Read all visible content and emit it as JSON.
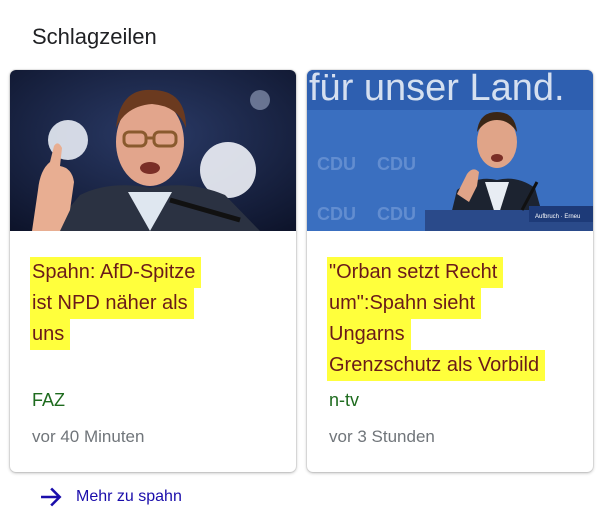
{
  "section": {
    "title": "Schlagzeilen"
  },
  "cards": [
    {
      "headline_lines": [
        "Spahn: AfD-Spitze",
        "ist NPD näher als",
        "uns"
      ],
      "source": "FAZ",
      "time": "vor 40 Minuten",
      "image": "speaker-at-podium-photo"
    },
    {
      "headline_lines": [
        "\"Orban setzt Recht",
        "um\":Spahn sieht",
        "Ungarns",
        "Grenzschutz als Vorbild"
      ],
      "source": "n-tv",
      "time": "vor 3 Stunden",
      "image": "speaker-on-stage-photo",
      "image_text": {
        "banner": "für unser Land.",
        "backdrop": [
          "CDU",
          "CDU",
          "CDU",
          "CDU"
        ],
        "tag": "Aufbruch · Erneu"
      }
    }
  ],
  "more": {
    "label": "Mehr zu spahn",
    "icon": "arrow-right-icon"
  },
  "colors": {
    "highlight": "#ffff3c",
    "headline_text": "#6a1a1a",
    "source_text": "#1e6b1e",
    "link": "#1a0dab",
    "arrow": "#1a0dab"
  }
}
